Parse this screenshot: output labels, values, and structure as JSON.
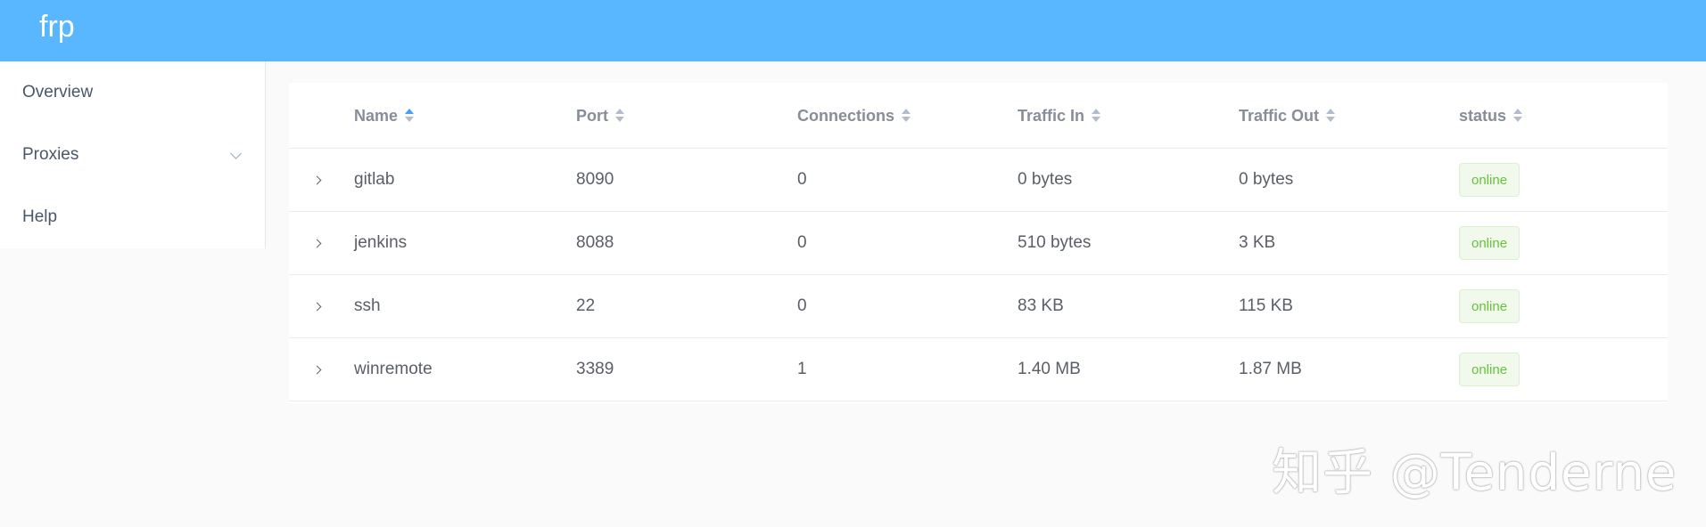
{
  "header": {
    "brand": "frp",
    "background": "#58b7ff"
  },
  "sidebar": {
    "items": [
      {
        "label": "Overview"
      },
      {
        "label": "Proxies",
        "icon": "chevron-down-icon"
      },
      {
        "label": "Help"
      }
    ]
  },
  "table": {
    "columns": [
      {
        "label": "Name",
        "sort": "ascending"
      },
      {
        "label": "Port",
        "sort": "none"
      },
      {
        "label": "Connections",
        "sort": "none"
      },
      {
        "label": "Traffic In",
        "sort": "none"
      },
      {
        "label": "Traffic Out",
        "sort": "none"
      },
      {
        "label": "status",
        "sort": "none"
      }
    ],
    "rows": [
      {
        "name": "gitlab",
        "port": "8090",
        "connections": "0",
        "traffic_in": "0 bytes",
        "traffic_out": "0 bytes",
        "status": "online"
      },
      {
        "name": "jenkins",
        "port": "8088",
        "connections": "0",
        "traffic_in": "510 bytes",
        "traffic_out": "3 KB",
        "status": "online"
      },
      {
        "name": "ssh",
        "port": "22",
        "connections": "0",
        "traffic_in": "83 KB",
        "traffic_out": "115 KB",
        "status": "online"
      },
      {
        "name": "winremote",
        "port": "3389",
        "connections": "1",
        "traffic_in": "1.40 MB",
        "traffic_out": "1.87 MB",
        "status": "online"
      }
    ],
    "status_color": "#67c23a"
  },
  "watermark": {
    "text": "知乎 @Tenderne"
  }
}
